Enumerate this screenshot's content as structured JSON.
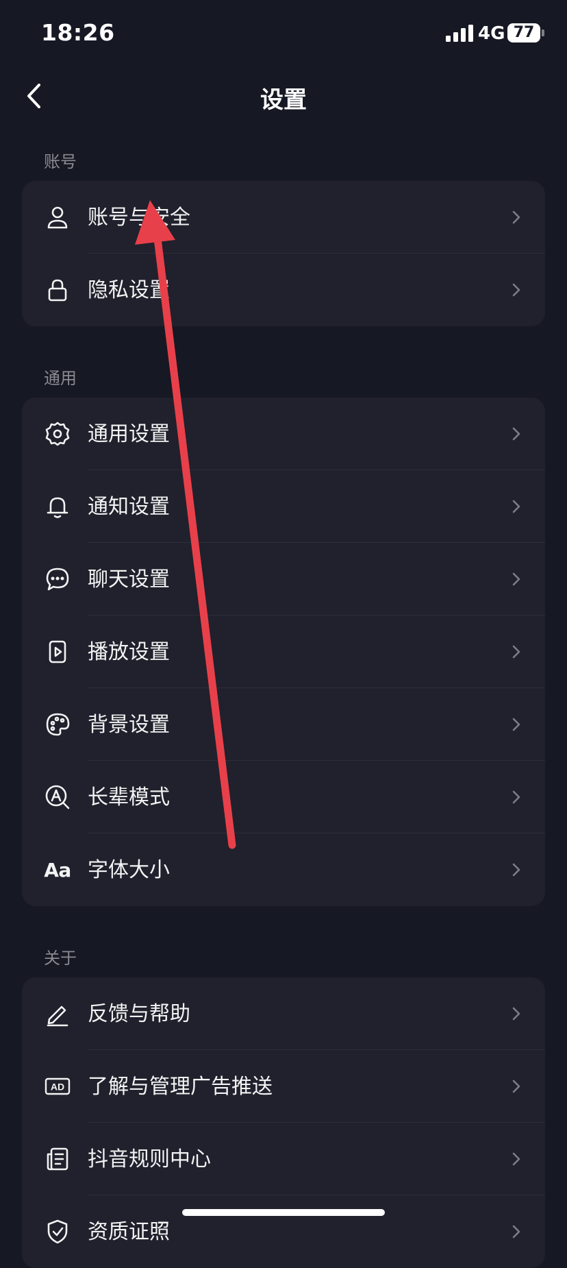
{
  "status": {
    "time": "18:26",
    "network": "4G",
    "battery": "77"
  },
  "nav": {
    "title": "设置"
  },
  "sections": {
    "account": {
      "header": "账号",
      "items": [
        {
          "label": "账号与安全",
          "icon": "user-icon"
        },
        {
          "label": "隐私设置",
          "icon": "lock-icon"
        }
      ]
    },
    "general": {
      "header": "通用",
      "items": [
        {
          "label": "通用设置",
          "icon": "gear-icon"
        },
        {
          "label": "通知设置",
          "icon": "bell-icon"
        },
        {
          "label": "聊天设置",
          "icon": "chat-icon"
        },
        {
          "label": "播放设置",
          "icon": "play-icon"
        },
        {
          "label": "背景设置",
          "icon": "palette-icon"
        },
        {
          "label": "长辈模式",
          "icon": "elder-mode-icon"
        },
        {
          "label": "字体大小",
          "icon": "font-size-icon",
          "glyph": "Aa"
        }
      ]
    },
    "about": {
      "header": "关于",
      "items": [
        {
          "label": "反馈与帮助",
          "icon": "pen-icon"
        },
        {
          "label": "了解与管理广告推送",
          "icon": "ad-icon",
          "glyph": "AD"
        },
        {
          "label": "抖音规则中心",
          "icon": "rules-icon"
        },
        {
          "label": "资质证照",
          "icon": "shield-icon"
        }
      ]
    }
  },
  "colors": {
    "background": "#161823",
    "card": "#20212c",
    "section_header": "#8a8b91",
    "annotation_arrow": "#e8404a"
  }
}
